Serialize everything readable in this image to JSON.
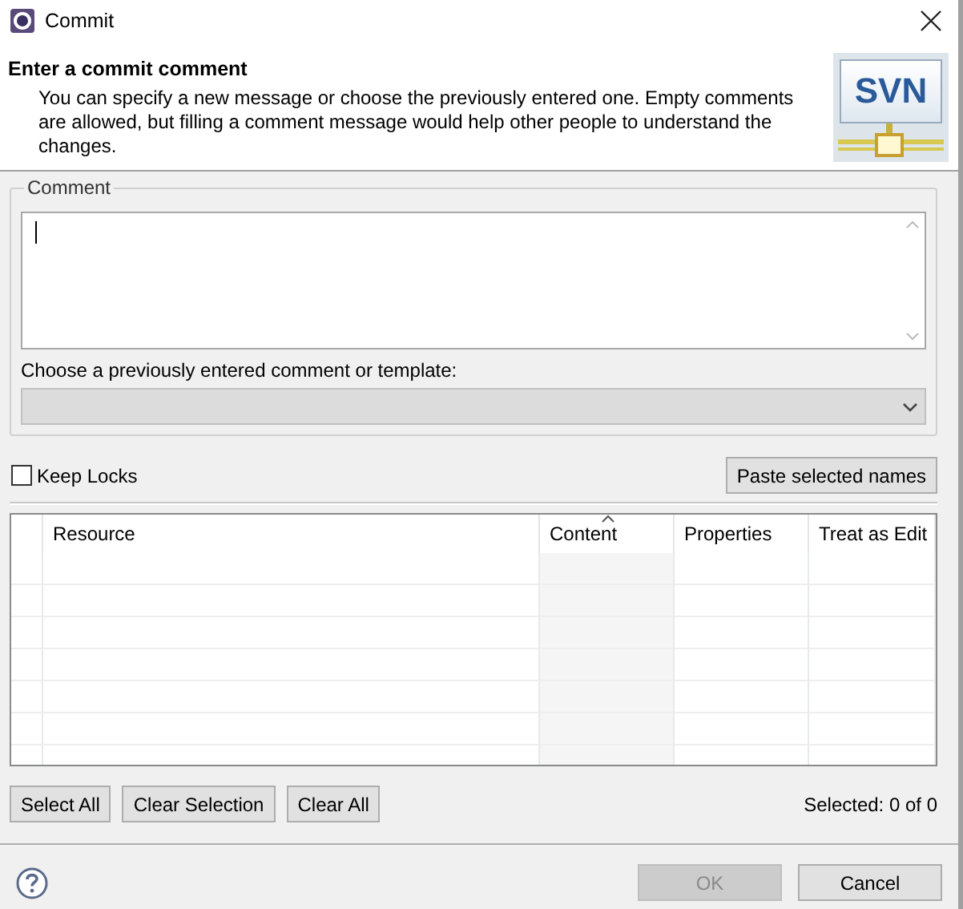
{
  "window": {
    "title": "Commit"
  },
  "header": {
    "title": "Enter a commit comment",
    "description": "You can specify a new message or choose the previously entered one. Empty comments are allowed, but filling a comment message would help other people to understand the changes.",
    "logo_text": "SVN"
  },
  "comment": {
    "label": "Comment"
  },
  "history": {
    "label": "Choose a previously entered comment or template:",
    "disabled": true
  },
  "keep_locks": {
    "label": "Keep Locks",
    "checked": false
  },
  "paste_button": "Paste selected names",
  "table": {
    "columns": [
      {
        "label": "Resource",
        "sorted": false
      },
      {
        "label": "Content",
        "sorted": true
      },
      {
        "label": "Properties",
        "sorted": false
      },
      {
        "label": "Treat as Edit",
        "sorted": false
      }
    ]
  },
  "selection_buttons": [
    {
      "label": "Select All"
    },
    {
      "label": "Clear Selection"
    },
    {
      "label": "Clear All"
    }
  ],
  "selection_status": "Selected: 0 of 0",
  "dialog_buttons": [
    {
      "label": "OK",
      "disabled": true
    },
    {
      "label": "Cancel",
      "disabled": false
    }
  ]
}
